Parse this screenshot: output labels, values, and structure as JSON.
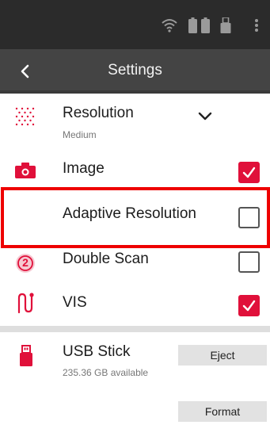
{
  "header": {
    "title": "Settings"
  },
  "statusbar": {
    "icons": [
      "wifi-icon",
      "battery-icon",
      "battery-icon",
      "usb-drive-icon",
      "overflow-menu-icon"
    ]
  },
  "settings": {
    "resolution": {
      "label": "Resolution",
      "value": "Medium",
      "icon": "resolution-dots-icon"
    },
    "image": {
      "label": "Image",
      "checked": true,
      "icon": "camera-icon"
    },
    "adaptive_resolution": {
      "label": "Adaptive Resolution",
      "checked": false
    },
    "double_scan": {
      "label": "Double Scan",
      "checked": false,
      "icon": "double-scan-icon",
      "badge": "2"
    },
    "vis": {
      "label": "VIS",
      "checked": true,
      "icon": "vis-icon"
    }
  },
  "storage": {
    "label": "USB Stick",
    "available": "235.36 GB available",
    "eject_label": "Eject",
    "format_label": "Format",
    "icon": "usb-stick-icon"
  },
  "colors": {
    "accent": "#e0103a",
    "highlight": "#ee0000",
    "statusbar": "#2b2b2b",
    "appbar": "#444444"
  }
}
